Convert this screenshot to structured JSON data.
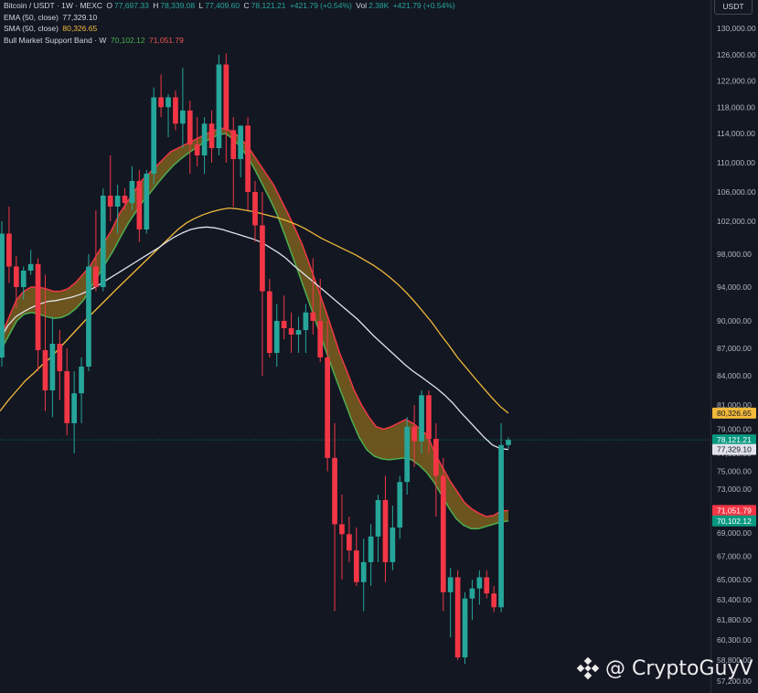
{
  "header": {
    "symbol": "Bitcoin / USDT · 1W · MEXC",
    "open_label": "O",
    "open": "77,697.33",
    "high_label": "H",
    "high": "78,339.08",
    "low_label": "L",
    "low": "77,409.60",
    "close_label": "C",
    "close": "78,121.21",
    "change": "+421.79 (+0.54%)",
    "vol_label": "Vol",
    "vol": "2.38K",
    "vol_change": "+421.79 (+0.54%)",
    "currency": "USDT"
  },
  "indicators": {
    "ema_label": "EMA (50, close)",
    "ema_value": "77,329.10",
    "sma_label": "SMA (50, close)",
    "sma_value": "80,326.65",
    "band_label": "Bull Market Support Band · W",
    "band_upper": "70,102.12",
    "band_lower": "71,051.79"
  },
  "watermark": "@ CryptoGuyV",
  "colors": {
    "up": "#26a69a",
    "down": "#f23645",
    "ema": "#e0e3eb",
    "sma": "#f0b93a",
    "band_green": "#4caf50",
    "band_red": "#f23645",
    "background": "#131722"
  },
  "chart_data": {
    "type": "candlestick",
    "y_axis_labels": [
      "130,000.00",
      "126,000.00",
      "122,000.00",
      "118,000.00",
      "114,000.00",
      "110,000.00",
      "106,000.00",
      "102,000.00",
      "98,000.00",
      "94,000.00",
      "90,000.00",
      "87,000.00",
      "84,000.00",
      "81,000.00",
      "79,000.00",
      "77,000.00",
      "75,000.00",
      "73,000.00",
      "71,000.00",
      "69,000.00",
      "67,000.00",
      "65,000.00",
      "63,400.00",
      "61,800.00",
      "60,300.00",
      "58,800.00",
      "57,200.00"
    ],
    "price_tags": [
      {
        "value": 80326.65,
        "text": "80,326.65",
        "color": "#f0b93a",
        "text_color": "#131722"
      },
      {
        "value": 78121.21,
        "text": "78,121.21",
        "subtext": "6d 16h",
        "color": "#089981",
        "text_color": "#ffffff"
      },
      {
        "value": 77329.1,
        "text": "77,329.10",
        "color": "#e0e3eb",
        "text_color": "#131722"
      },
      {
        "value": 71051.79,
        "text": "71,051.79",
        "color": "#f23645",
        "text_color": "#ffffff"
      },
      {
        "value": 70102.12,
        "text": "70,102.12",
        "color": "#089981",
        "text_color": "#ffffff"
      }
    ],
    "candles": [
      [
        86000,
        102000,
        85000,
        100500
      ],
      [
        100500,
        104000,
        94500,
        96500
      ],
      [
        96500,
        97800,
        91500,
        94000
      ],
      [
        94000,
        96500,
        92500,
        96000
      ],
      [
        96000,
        98500,
        95500,
        96800
      ],
      [
        96800,
        97500,
        84500,
        86800
      ],
      [
        86800,
        95500,
        80500,
        82500
      ],
      [
        82500,
        90500,
        80000,
        87500
      ],
      [
        87500,
        89000,
        81500,
        84500
      ],
      [
        84500,
        87000,
        78500,
        79500
      ],
      [
        79500,
        84500,
        77000,
        82200
      ],
      [
        82200,
        86000,
        79500,
        85000
      ],
      [
        85000,
        98000,
        84500,
        96500
      ],
      [
        96500,
        103500,
        93500,
        94000
      ],
      [
        94000,
        106500,
        93500,
        105500
      ],
      [
        105500,
        111000,
        102000,
        104000
      ],
      [
        104000,
        107000,
        100500,
        105500
      ],
      [
        105500,
        106500,
        103500,
        104500
      ],
      [
        104500,
        109500,
        103500,
        107500
      ],
      [
        107500,
        109000,
        99500,
        101000
      ],
      [
        101000,
        109000,
        100500,
        108500
      ],
      [
        108500,
        121000,
        107000,
        119500
      ],
      [
        119500,
        123000,
        116500,
        118000
      ],
      [
        118000,
        120000,
        113500,
        119500
      ],
      [
        119500,
        120500,
        114500,
        115500
      ],
      [
        115500,
        124000,
        112000,
        117500
      ],
      [
        117500,
        119000,
        108500,
        112500
      ],
      [
        112500,
        116500,
        109500,
        111000
      ],
      [
        111000,
        116500,
        108500,
        115500
      ],
      [
        115500,
        117500,
        110000,
        112000
      ],
      [
        112000,
        126000,
        111000,
        124500
      ],
      [
        124500,
        126200,
        110000,
        114500
      ],
      [
        114500,
        116500,
        104000,
        110500
      ],
      [
        110500,
        115000,
        108000,
        115200
      ],
      [
        115200,
        116500,
        103500,
        106000
      ],
      [
        106000,
        107500,
        99500,
        101500
      ],
      [
        101500,
        106000,
        84000,
        93500
      ],
      [
        93500,
        95000,
        86000,
        86500
      ],
      [
        86500,
        92000,
        85000,
        90000
      ],
      [
        90000,
        93000,
        88000,
        89200
      ],
      [
        89200,
        91000,
        86500,
        88500
      ],
      [
        88500,
        90500,
        86500,
        89000
      ],
      [
        89000,
        92000,
        86500,
        91000
      ],
      [
        91000,
        97500,
        88500,
        90000
      ],
      [
        90000,
        95000,
        85500,
        86000
      ],
      [
        86000,
        90000,
        75000,
        76500
      ],
      [
        76500,
        79500,
        62500,
        69800
      ],
      [
        69800,
        72500,
        65000,
        68900
      ],
      [
        68900,
        70500,
        66500,
        67500
      ],
      [
        67500,
        69500,
        64500,
        64800
      ],
      [
        64800,
        68500,
        62500,
        66500
      ],
      [
        66500,
        69800,
        64500,
        68700
      ],
      [
        68700,
        72500,
        66500,
        72000
      ],
      [
        72000,
        74500,
        64800,
        66500
      ],
      [
        66500,
        71500,
        65800,
        69500
      ],
      [
        69500,
        74500,
        68500,
        73800
      ],
      [
        73800,
        80000,
        72500,
        79200
      ],
      [
        79200,
        81000,
        75500,
        78000
      ],
      [
        78000,
        82500,
        77000,
        82000
      ],
      [
        82000,
        82500,
        77000,
        78200
      ],
      [
        78200,
        79500,
        70500,
        74500
      ],
      [
        74500,
        76500,
        62500,
        64000
      ],
      [
        64000,
        66000,
        60500,
        65200
      ],
      [
        65200,
        65800,
        58800,
        59000
      ],
      [
        59000,
        64000,
        58500,
        63500
      ],
      [
        63500,
        65000,
        61800,
        64300
      ],
      [
        64300,
        65800,
        63000,
        65200
      ],
      [
        65200,
        65800,
        63500,
        63900
      ],
      [
        63900,
        64500,
        62400,
        62800
      ],
      [
        62800,
        79500,
        62400,
        77697
      ],
      [
        77697,
        78339,
        77409,
        78121
      ]
    ],
    "ema_50": [
      88000,
      89500,
      90500,
      91100,
      91600,
      92000,
      92300,
      92400,
      92600,
      92800,
      93100,
      93500,
      94000,
      94600,
      95200,
      95800,
      96400,
      97000,
      97600,
      98200,
      98800,
      99500,
      100100,
      100600,
      101000,
      101200,
      101300,
      101200,
      101000,
      100700,
      100400,
      100100,
      99800,
      99400,
      98800,
      98200,
      97500,
      96600,
      95800,
      95000,
      94200,
      93400,
      92600,
      91800,
      91000,
      90200,
      89300,
      88400,
      87600,
      86800,
      86000,
      85200,
      84500,
      83900,
      83300,
      82700,
      82000,
      81200,
      80400,
      79700,
      79000,
      78300,
      77700,
      77400,
      77329
    ],
    "sma_50": [
      80500,
      81500,
      82500,
      83500,
      84300,
      85200,
      86000,
      87000,
      88000,
      89000,
      90000,
      91000,
      92000,
      93000,
      94000,
      95000,
      96000,
      97000,
      98000,
      99000,
      100000,
      101000,
      101800,
      102400,
      102900,
      103300,
      103600,
      103800,
      103700,
      103500,
      103300,
      103000,
      102700,
      102400,
      102000,
      101600,
      101100,
      100500,
      99900,
      99400,
      98900,
      98400,
      97900,
      97300,
      96700,
      96000,
      95200,
      94300,
      93300,
      92200,
      91000,
      89800,
      88500,
      87300,
      86000,
      84900,
      83800,
      82800,
      81800,
      80900,
      80326
    ],
    "band_upper": [
      88500,
      90500,
      92500,
      93500,
      94000,
      94000,
      93800,
      93500,
      93500,
      93800,
      94500,
      95500,
      96500,
      98000,
      99500,
      101000,
      103000,
      104500,
      106000,
      107500,
      108500,
      109500,
      110500,
      111500,
      112000,
      112500,
      113000,
      113500,
      114000,
      114500,
      114800,
      114500,
      113800,
      112800,
      111500,
      110000,
      108500,
      107000,
      105000,
      103000,
      101000,
      99000,
      96500,
      94000,
      91500,
      89000,
      86500,
      84500,
      82500,
      81000,
      80000,
      79200,
      79000,
      79200,
      79500,
      79800,
      79500,
      79000,
      78500,
      77000,
      75500,
      74000,
      72800,
      71800,
      71200,
      70800,
      70500,
      70600,
      71000,
      71051
    ],
    "band_lower": [
      87000,
      88500,
      90000,
      90800,
      91000,
      90800,
      90500,
      90300,
      90400,
      90800,
      91500,
      92500,
      94000,
      95500,
      97000,
      98500,
      100200,
      101800,
      103300,
      104800,
      106000,
      107300,
      108500,
      109600,
      110500,
      111300,
      112000,
      112700,
      113300,
      113800,
      114000,
      113300,
      112200,
      110800,
      109000,
      107000,
      105000,
      102800,
      100300,
      97800,
      95300,
      92800,
      90300,
      87900,
      85600,
      83400,
      81400,
      79700,
      78300,
      77300,
      76700,
      76400,
      76300,
      76400,
      76500,
      76300,
      75700,
      74900,
      73800,
      72500,
      71300,
      70300,
      69700,
      69400,
      69400,
      69600,
      69800,
      70000,
      70102
    ]
  }
}
